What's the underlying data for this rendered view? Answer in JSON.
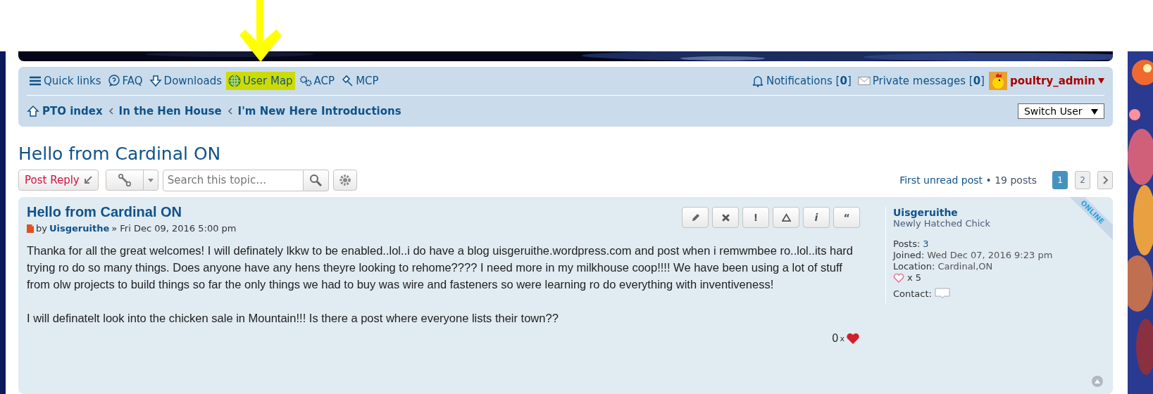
{
  "nav_links": [
    {
      "label": "Quick links",
      "kind": "menu",
      "highlighted": false
    },
    {
      "label": "FAQ",
      "kind": "faq",
      "highlighted": false
    },
    {
      "label": "Downloads",
      "kind": "download",
      "highlighted": false
    },
    {
      "label": "User Map",
      "kind": "globe",
      "highlighted": true
    },
    {
      "label": "ACP",
      "kind": "gears",
      "highlighted": false
    },
    {
      "label": "MCP",
      "kind": "hammer",
      "highlighted": false
    }
  ],
  "notifications": {
    "label": "Notifications",
    "count": "[**0**]"
  },
  "private_messages": {
    "label": "Private messages",
    "count": "[**0**]"
  },
  "user": {
    "name": "poultry_admin"
  },
  "breadcrumbs": [
    "PTO index",
    "In the Hen House",
    "I'm New Here Introductions"
  ],
  "switch_user": "Switch User",
  "topic_title": "Hello from Cardinal ON",
  "post_reply": "Post Reply",
  "search": {
    "placeholder": "Search this topic…"
  },
  "pagination": {
    "first_unread": "First unread post",
    "posts": "• 19 posts",
    "pages": [
      {
        "label": "1",
        "selected": true
      },
      {
        "label": "2",
        "selected": false
      }
    ]
  },
  "post": {
    "title": "Hello from Cardinal ON",
    "by": "by",
    "author": "Uisgeruithe",
    "date": "» Fri Dec 09, 2016 5:00 pm",
    "actions": [
      {
        "kind": "edit"
      },
      {
        "kind": "delete"
      },
      {
        "kind": "report",
        "glyph": "!"
      },
      {
        "kind": "warn"
      },
      {
        "kind": "info",
        "glyph": "i"
      },
      {
        "kind": "quote",
        "glyph": "“"
      }
    ],
    "paragraphs": [
      "Thanka for all the great welcomes! I will definately lkkw to be enabled..lol..i do have a blog uisgeruithe.wordpress.com and post when i remwmbee ro..lol..its hard trying ro do so many things. Does anyone have any hens theyre looking to rehome???? I need more in my milkhouse coop!!!! We have been using a lot of stuff from olw projects to build things so far the only things we had to buy was wire and fasteners so were learning ro do everything with inventiveness!",
      "I will definatelt look into the chicken sale in Mountain!!! Is there a post where everyone lists their town??"
    ],
    "likes": "0",
    "likes_x": "x",
    "online": "ONLINE"
  },
  "profile": {
    "name": "Uisgeruithe",
    "rank": "Newly Hatched Chick",
    "fields": [
      {
        "label": "Posts:",
        "value": "3",
        "link": true
      },
      {
        "label": "Joined:",
        "value": "Wed Dec 07, 2016 9:23 pm",
        "link": false
      },
      {
        "label": "Location:",
        "value": "Cardinal,ON",
        "link": false
      }
    ],
    "likes": "x 5",
    "contact": "Contact:"
  }
}
